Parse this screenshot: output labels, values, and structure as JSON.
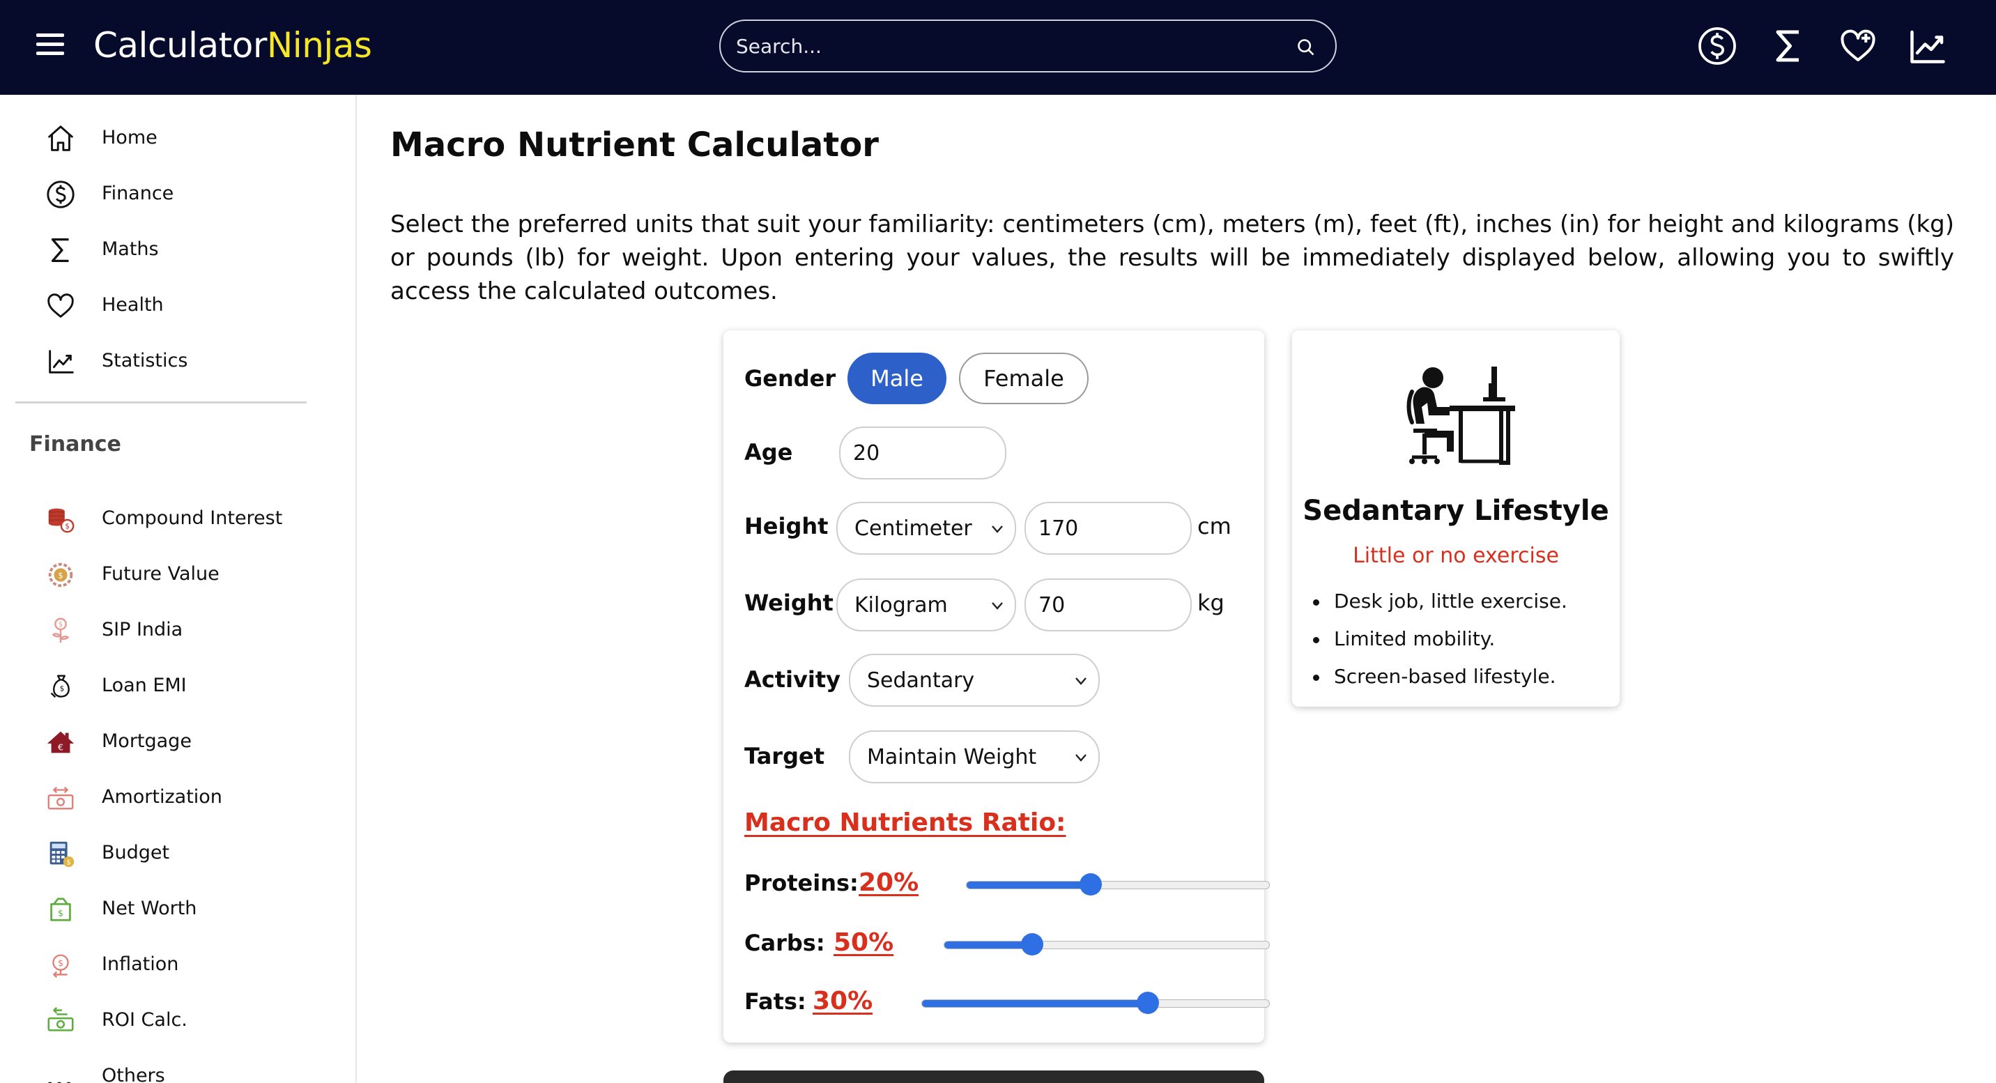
{
  "header": {
    "logo_primary": "Calculator",
    "logo_accent": "Ninjas",
    "search_placeholder": "Search...",
    "icons": [
      "dollar-circle-icon",
      "sigma-icon",
      "heart-plus-icon",
      "trend-chart-icon"
    ]
  },
  "sidebar": {
    "main_items": [
      {
        "label": "Home",
        "icon": "home-icon"
      },
      {
        "label": "Finance",
        "icon": "dollar-circle-icon"
      },
      {
        "label": "Maths",
        "icon": "sigma-icon"
      },
      {
        "label": "Health",
        "icon": "heart-icon"
      },
      {
        "label": "Statistics",
        "icon": "trend-chart-icon"
      }
    ],
    "section_heading": "Finance",
    "finance_items": [
      {
        "label": "Compound Interest",
        "icon": "coin-stack-icon"
      },
      {
        "label": "Future Value",
        "icon": "coin-gear-icon"
      },
      {
        "label": "SIP India",
        "icon": "money-plant-icon"
      },
      {
        "label": "Loan EMI",
        "icon": "money-bag-hand-icon"
      },
      {
        "label": "Mortgage",
        "icon": "house-euro-icon"
      },
      {
        "label": "Amortization",
        "icon": "banknote-cycle-icon"
      },
      {
        "label": "Budget",
        "icon": "calculator-icon"
      },
      {
        "label": "Net Worth",
        "icon": "wallet-dollar-icon"
      },
      {
        "label": "Inflation",
        "icon": "inflation-coin-icon"
      },
      {
        "label": "ROI Calc.",
        "icon": "cash-return-icon"
      },
      {
        "label": "Others",
        "icon": "more-dots-icon"
      }
    ]
  },
  "main": {
    "title": "Macro Nutrient Calculator",
    "intro": "Select the preferred units that suit your familiarity: centimeters (cm), meters (m), feet (ft), inches (in) for height and kilograms (kg) or pounds (lb) for weight. Upon entering your values, the results will be immediately displayed below, allowing you to swiftly access the calculated outcomes."
  },
  "form": {
    "gender_label": "Gender",
    "gender_options": [
      "Male",
      "Female"
    ],
    "gender_selected": "Male",
    "age_label": "Age",
    "age_value": "20",
    "height_label": "Height",
    "height_unit_select": "Centimeter",
    "height_value": "170",
    "height_unit": "cm",
    "weight_label": "Weight",
    "weight_unit_select": "Kilogram",
    "weight_value": "70",
    "weight_unit": "kg",
    "activity_label": "Activity",
    "activity_value": "Sedantary",
    "target_label": "Target",
    "target_value": "Maintain Weight",
    "ratio_title": "Macro Nutrients Ratio:",
    "macros": [
      {
        "label": "Proteins:",
        "display": "20%",
        "slider_level": 0.41
      },
      {
        "label": "Carbs:",
        "display": "50%",
        "slider_level": 0.27
      },
      {
        "label": "Fats:",
        "display": "30%",
        "slider_level": 0.65
      }
    ]
  },
  "lifestyle": {
    "icon": "desk-worker-icon",
    "title": "Sedantary Lifestyle",
    "subtitle": "Little or no exercise",
    "points": [
      "Desk job, little exercise.",
      "Limited mobility.",
      "Screen-based lifestyle."
    ]
  },
  "colors": {
    "header_bg": "#070b2b",
    "logo_accent": "#f6e62a",
    "primary_blue": "#2d60c8",
    "slider_blue": "#2f6fe4",
    "accent_red": "#d9301e"
  }
}
